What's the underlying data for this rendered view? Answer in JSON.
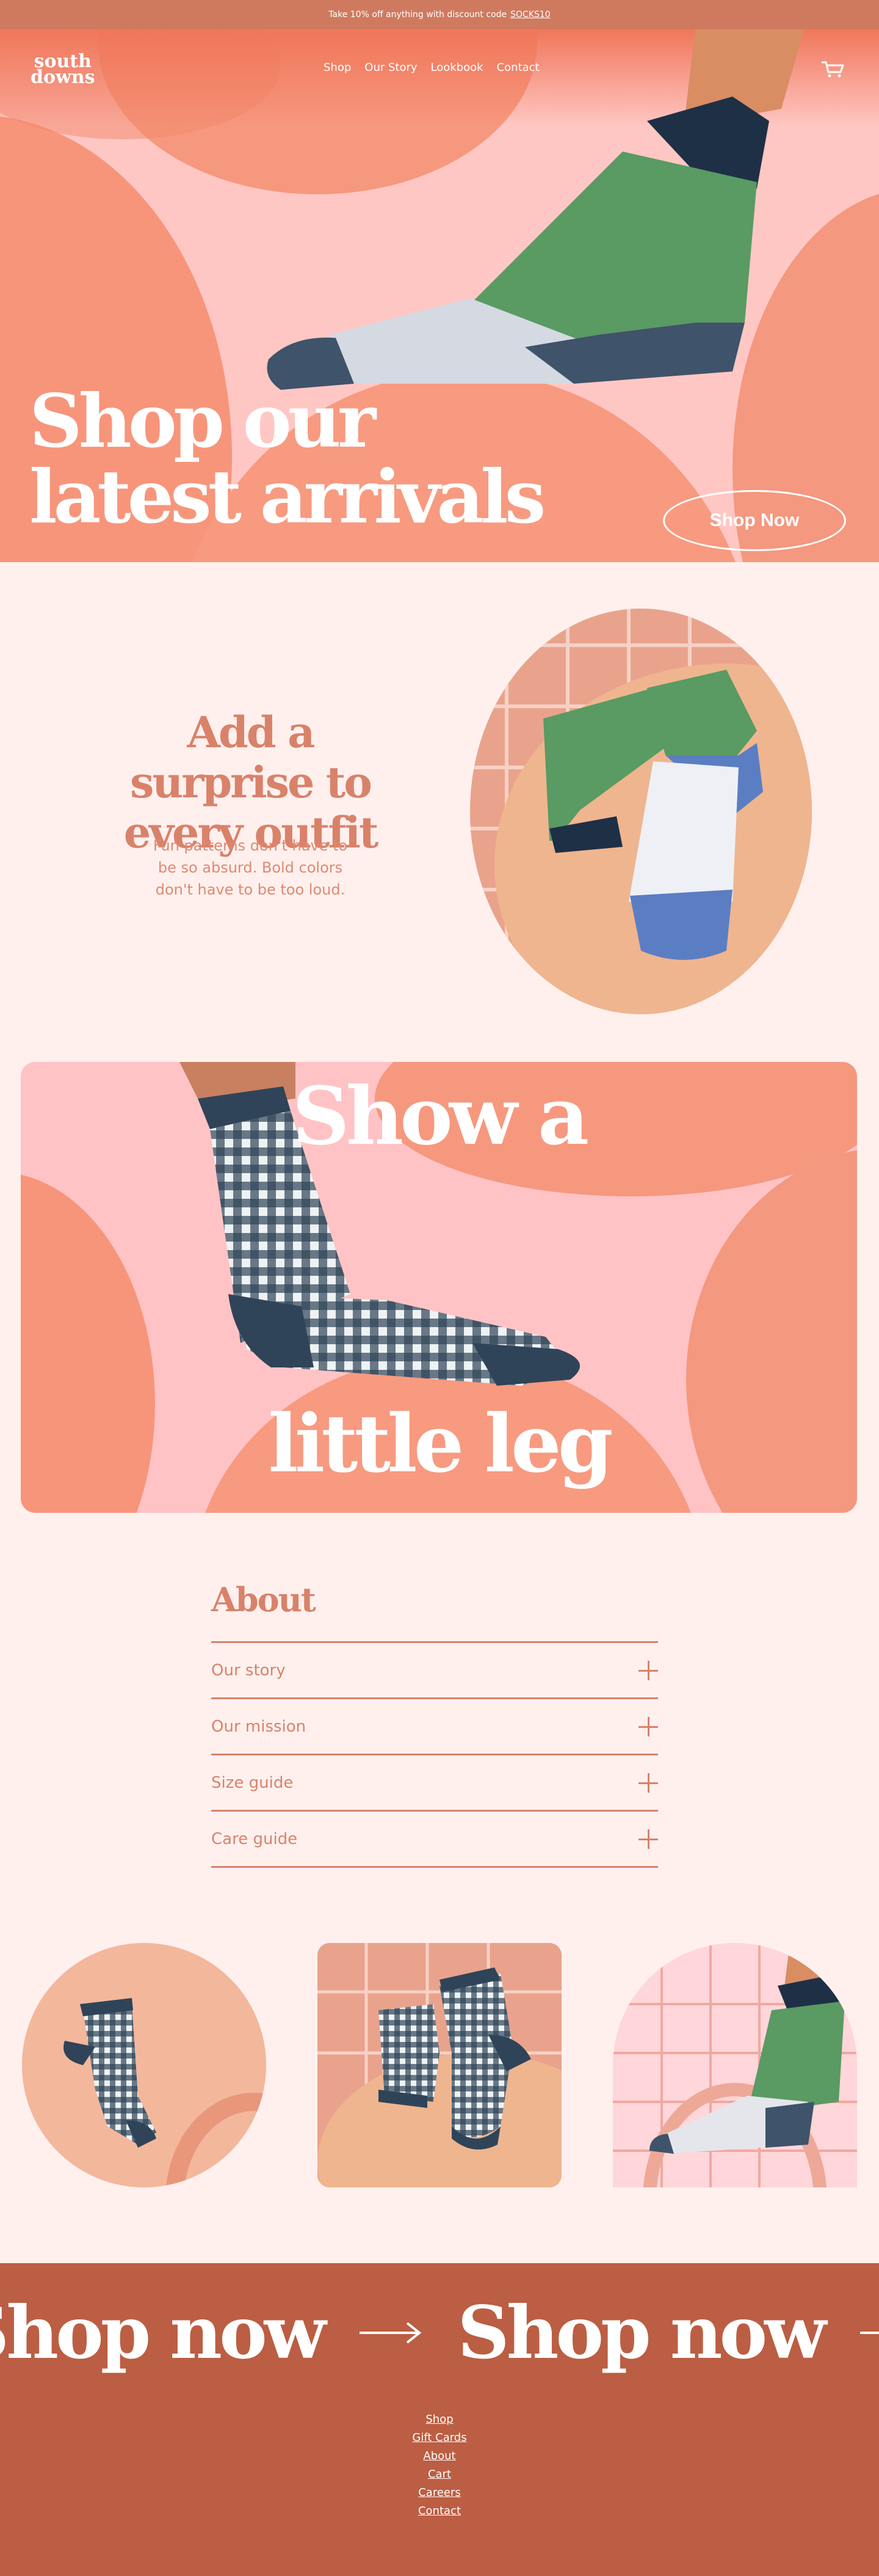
{
  "announcement": {
    "text": "Take 10% off anything with discount code",
    "code": "SOCKS10"
  },
  "brand": {
    "logo_line1": "south",
    "logo_line2": "downs"
  },
  "nav": {
    "items": [
      {
        "label": "Shop"
      },
      {
        "label": "Our Story"
      },
      {
        "label": "Lookbook"
      },
      {
        "label": "Contact"
      }
    ],
    "cart_icon": "cart-icon"
  },
  "hero": {
    "title_line1": "Shop our",
    "title_line2": "latest arrivals",
    "cta": "Shop Now"
  },
  "surprise": {
    "title": "Add a surprise to every outfit",
    "text": "Fun patterns don't have to be so absurd. Bold colors don't have to be too loud."
  },
  "leg": {
    "top": "Show a",
    "bottom": "little leg"
  },
  "about": {
    "title": "About",
    "items": [
      {
        "label": "Our story"
      },
      {
        "label": "Our mission"
      },
      {
        "label": "Size guide"
      },
      {
        "label": "Care guide"
      }
    ]
  },
  "marquee": {
    "text": "Shop now"
  },
  "footer": {
    "links": [
      {
        "label": "Shop"
      },
      {
        "label": "Gift Cards"
      },
      {
        "label": "About"
      },
      {
        "label": "Cart"
      },
      {
        "label": "Careers"
      },
      {
        "label": "Contact"
      }
    ]
  },
  "colors": {
    "background": "#fff0ee",
    "accent": "#d9826a",
    "footer": "#bb5e43",
    "hero_pink": "#ffc7c4",
    "sock_green": "#5a9a63",
    "sock_navy": "#2f4458"
  }
}
